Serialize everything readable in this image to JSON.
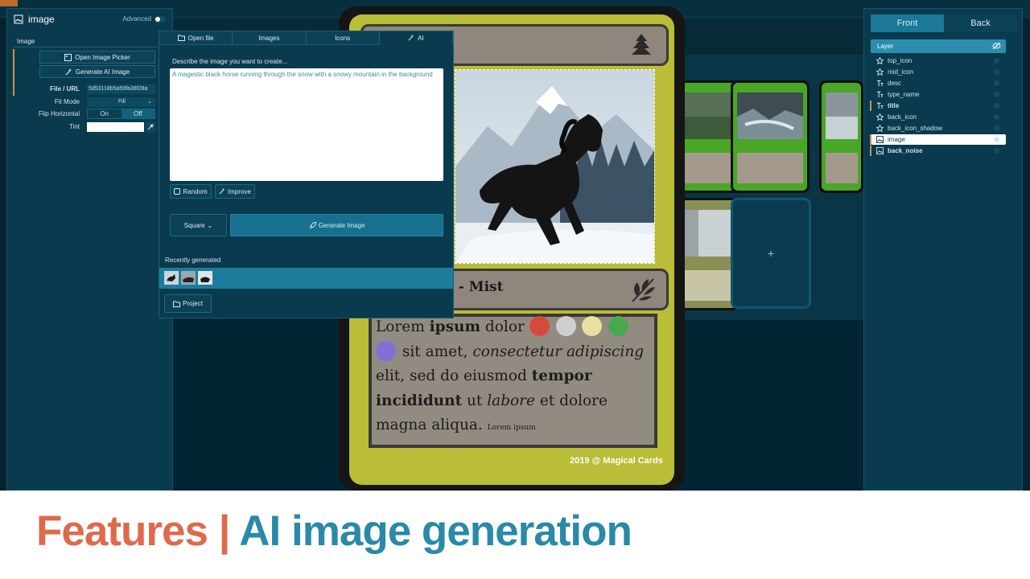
{
  "left_panel": {
    "title": "image",
    "advanced_label": "Advanced",
    "section": "Image",
    "open_picker": "Open Image Picker",
    "generate_ai": "Generate AI Image",
    "file_url_label": "File / URL",
    "file_url_value": "5d53118b5a59fa38f28a",
    "fit_mode_label": "Fit Mode",
    "fit_mode_value": "Fill",
    "flip_label": "Flip Horizontal",
    "flip_on": "On",
    "flip_off": "Off",
    "tint_label": "Tint"
  },
  "popup": {
    "tabs": [
      {
        "label": "Open file",
        "icon": "folder-icon"
      },
      {
        "label": "Images",
        "icon": ""
      },
      {
        "label": "Icons",
        "icon": ""
      },
      {
        "label": "AI",
        "icon": "magic-wand-icon"
      }
    ],
    "describe_label": "Describe the image you want to create...",
    "prompt": "A magestic black horse running through the snow with a snowy mountain in the background",
    "random_label": "Random",
    "improve_label": "Improve",
    "aspect_label": "Square",
    "generate_label": "Generate Image",
    "recent_label": "Recently generated",
    "project_label": "Project"
  },
  "card": {
    "type_line": "t - Mist",
    "rules": {
      "w1": "Lorem ",
      "w2": "ipsum",
      "w3": " dolor ",
      "w4": " sit amet, ",
      "w5": "consectetur adipiscing",
      "w6": "elit, sed do eiusmod ",
      "w7": "tempor",
      "w8": "incididunt",
      "w9": " ut ",
      "w10": "labore",
      "w11": " et dolore",
      "w12": "magna aliqua. ",
      "w13": "Lorem ipsum"
    },
    "copyright": "2019 @ Magical Cards",
    "mana_colors": [
      "#d64a3c",
      "#cfcfcf",
      "#e8e0a0",
      "#4aa84e",
      "#8070d8"
    ]
  },
  "gallery": {
    "add_label": "+"
  },
  "right_panel": {
    "tab_front": "Front",
    "tab_back": "Back",
    "layer_header": "Layer",
    "layers": [
      {
        "name": "top_icon",
        "icon": "star-icon"
      },
      {
        "name": "mid_icon",
        "icon": "star-icon"
      },
      {
        "name": "desc",
        "icon": "text-icon"
      },
      {
        "name": "type_name",
        "icon": "text-icon"
      },
      {
        "name": "title",
        "icon": "text-icon"
      },
      {
        "name": "back_icon",
        "icon": "star-icon"
      },
      {
        "name": "back_icon_shadow",
        "icon": "star-icon"
      },
      {
        "name": "image",
        "icon": "image-icon"
      },
      {
        "name": "back_noise",
        "icon": "image-icon"
      }
    ]
  },
  "footer": {
    "word1": "Features",
    "sep": "|",
    "word2": "AI image generation"
  }
}
